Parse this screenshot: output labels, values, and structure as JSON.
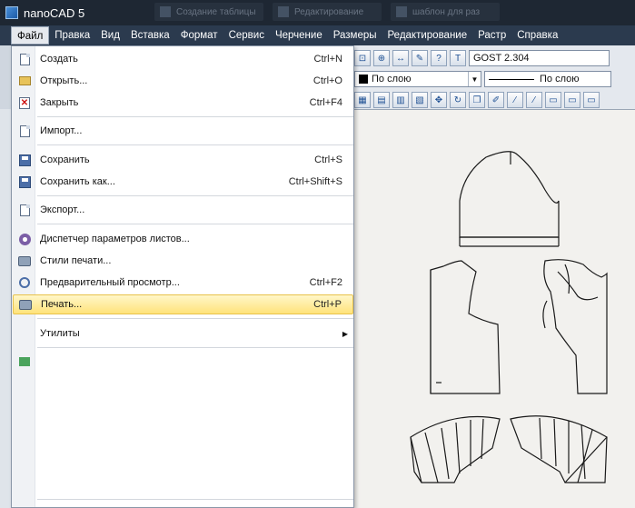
{
  "window": {
    "title": "nanoCAD 5",
    "background_tabs": [
      "Создание таблицы",
      "Редактирование",
      "шаблон для раз"
    ]
  },
  "menubar": {
    "items": [
      "Файл",
      "Правка",
      "Вид",
      "Вставка",
      "Формат",
      "Сервис",
      "Черчение",
      "Размеры",
      "Редактирование",
      "Растр",
      "Справка"
    ],
    "active": "Файл"
  },
  "toolbar": {
    "text_style": "GOST 2.304",
    "layer_color": "По слою",
    "linetype": "По слою"
  },
  "file_menu": {
    "items": [
      {
        "label": "Создать",
        "shortcut": "Ctrl+N",
        "icon": "new-document-icon"
      },
      {
        "label": "Открыть...",
        "shortcut": "Ctrl+O",
        "icon": "open-folder-icon"
      },
      {
        "label": "Закрыть",
        "shortcut": "Ctrl+F4",
        "icon": "close-document-icon"
      },
      {
        "label": "Импорт...",
        "shortcut": "",
        "icon": "import-icon"
      },
      {
        "label": "Сохранить",
        "shortcut": "Ctrl+S",
        "icon": "save-icon"
      },
      {
        "label": "Сохранить как...",
        "shortcut": "Ctrl+Shift+S",
        "icon": "save-as-icon"
      },
      {
        "label": "Экспорт...",
        "shortcut": "",
        "icon": "export-icon"
      },
      {
        "label": "Диспетчер параметров листов...",
        "shortcut": "",
        "icon": "page-setup-icon"
      },
      {
        "label": "Стили печати...",
        "shortcut": "",
        "icon": "print-styles-icon"
      },
      {
        "label": "Предварительный просмотр...",
        "shortcut": "Ctrl+F2",
        "icon": "print-preview-icon"
      },
      {
        "label": "Печать...",
        "shortcut": "Ctrl+P",
        "icon": "print-icon"
      },
      {
        "label": "Утилиты",
        "shortcut": "",
        "icon": ""
      }
    ],
    "highlighted": "Печать..."
  },
  "colors": {
    "titlebar": "#1e2733",
    "menubar": "#2b3a4e",
    "highlight": "#ffe37a",
    "canvas": "#f2f1ee"
  }
}
